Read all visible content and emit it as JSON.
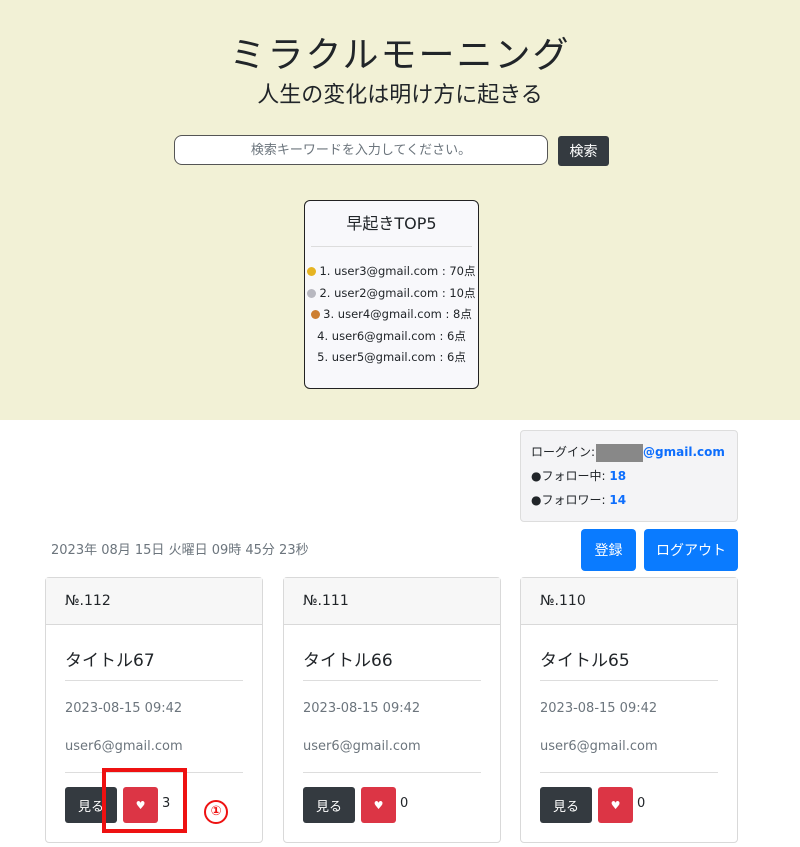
{
  "hero": {
    "title": "ミラクルモーニング",
    "subtitle": "人生の変化は明け方に起きる",
    "search_placeholder": "検索キーワードを入力してください。",
    "search_button": "検索",
    "background": "#f2f1d6"
  },
  "ranking": {
    "title": "早起きTOP5",
    "items": [
      {
        "medal": "gold-medal-icon",
        "text": "1. user3@gmail.com : 70点"
      },
      {
        "medal": "silver-medal-icon",
        "text": "2. user2@gmail.com : 10点"
      },
      {
        "medal": "bronze-medal-icon",
        "text": "3. user4@gmail.com : 8点"
      },
      {
        "medal": "",
        "text": "4. user6@gmail.com : 6点"
      },
      {
        "medal": "",
        "text": "5. user5@gmail.com : 6点"
      }
    ]
  },
  "account": {
    "login_label": "ローグイン:",
    "email_domain": "@gmail.com",
    "following_label": "●フォロー中:",
    "following_count": "18",
    "followers_label": "●フォロワー:",
    "followers_count": "14"
  },
  "datetime": "2023年 08月 15日 火曜日 09時 45分 23秒",
  "buttons": {
    "register": "登録",
    "logout": "ログアウト"
  },
  "colors": {
    "primary": "#0a7bff",
    "dark": "#343a40",
    "danger": "#dc3545",
    "annotation": "#ee1111"
  },
  "posts": [
    {
      "number": "№.112",
      "title": "タイトル67",
      "date": "2023-08-15 09:42",
      "user": "user6@gmail.com",
      "view_label": "見る",
      "like_icon": "heart-icon",
      "likes": "3"
    },
    {
      "number": "№.111",
      "title": "タイトル66",
      "date": "2023-08-15 09:42",
      "user": "user6@gmail.com",
      "view_label": "見る",
      "like_icon": "heart-icon",
      "likes": "0"
    },
    {
      "number": "№.110",
      "title": "タイトル65",
      "date": "2023-08-15 09:42",
      "user": "user6@gmail.com",
      "view_label": "見る",
      "like_icon": "heart-icon",
      "likes": "0"
    }
  ],
  "annotation": {
    "marker": "①"
  }
}
